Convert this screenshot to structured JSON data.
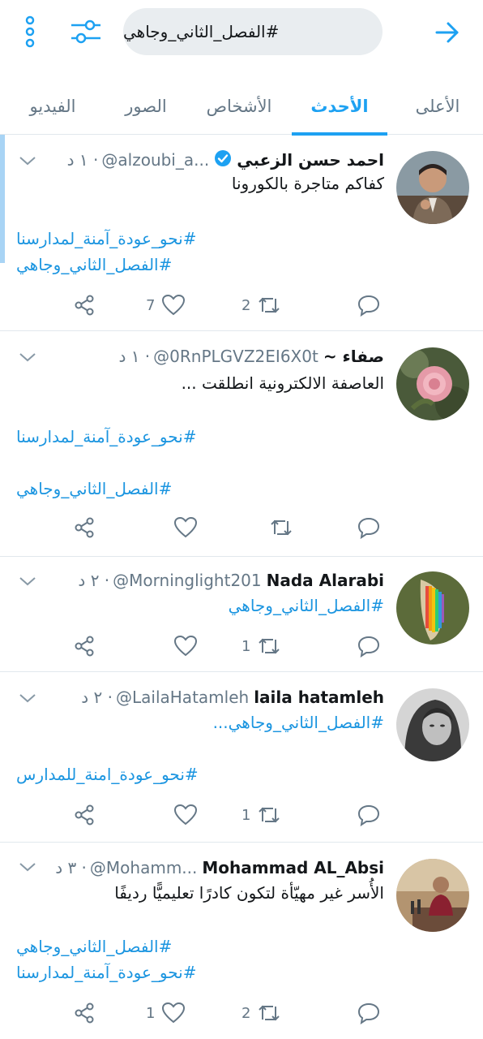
{
  "search": {
    "query": "#الفصل_الثاني_وجاهي"
  },
  "tabs": [
    {
      "label": "الأعلى",
      "active": false
    },
    {
      "label": "الأحدث",
      "active": true
    },
    {
      "label": "الأشخاص",
      "active": false
    },
    {
      "label": "الصور",
      "active": false
    },
    {
      "label": "الفيديو",
      "active": false
    }
  ],
  "colors": {
    "accent": "#1da1f2",
    "link": "#1b95e0",
    "muted": "#657786"
  },
  "tweets": [
    {
      "name": "احمد حسن الزعبي",
      "verified": true,
      "handle": "@alzoubi_a...",
      "time": "· ١ د",
      "text": "كفاكم متاجرة بالكورونا",
      "tags": [
        "#نحو_عودة_آمنة_لمدارسنا",
        "#الفصل_الثاني_وجاهي"
      ],
      "retweets": "2",
      "likes": "7"
    },
    {
      "name": "صفاء ~",
      "verified": false,
      "handle": "@0RnPLGVZ2EI6X0t",
      "time": "· ١ د",
      "text": "العاصفة الالكترونية انطلقت ...",
      "tags": [
        "#نحو_عودة_آمنة_لمدارسنا",
        "#الفصل_الثاني_وجاهي"
      ],
      "retweets": "",
      "likes": ""
    },
    {
      "name": "Nada Alarabi",
      "verified": false,
      "handle": "@Morninglight201",
      "time": "· ٢ د",
      "text": "",
      "tags": [
        "#الفصل_الثاني_وجاهي"
      ],
      "retweets": "1",
      "likes": ""
    },
    {
      "name": "laila hatamleh",
      "verified": false,
      "handle": "@LailaHatamleh",
      "time": "· ٢ د",
      "text": "",
      "tags": [
        "#الفصل_الثاني_وجاهي...",
        "#نحو_عودة_امنة_للمدارس"
      ],
      "retweets": "1",
      "likes": ""
    },
    {
      "name": "Mohammad AL_Absi",
      "verified": false,
      "handle": "@Mohamm...",
      "time": "· ٣ د",
      "text": "الأُسر غير مهيّأة لتكون كادرًا تعليميًّا رديفًا",
      "tags": [
        "#الفصل_الثاني_وجاهي",
        "#نحو_عودة_آمنة_لمدارسنا"
      ],
      "retweets": "2",
      "likes": "1"
    }
  ]
}
